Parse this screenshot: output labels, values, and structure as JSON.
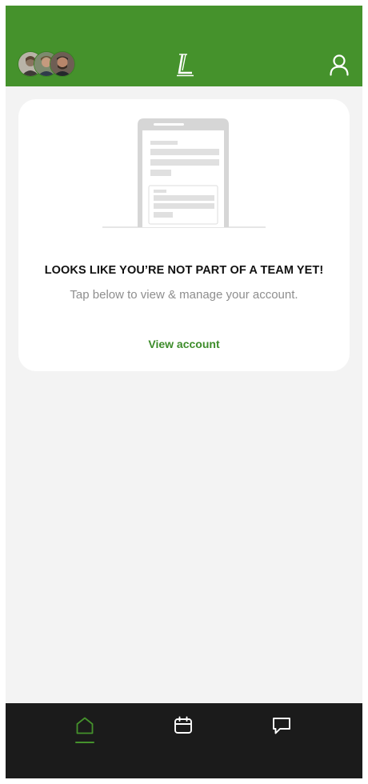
{
  "header": {
    "logo_letter": "L",
    "avatars": [
      "avatar-1",
      "avatar-2",
      "avatar-3"
    ]
  },
  "card": {
    "title": "LOOKS LIKE YOU’RE NOT PART OF A TEAM YET!",
    "subtitle": "Tap below to view & manage your account.",
    "link_label": "View account"
  },
  "nav": {
    "items": [
      {
        "icon": "home-icon",
        "active": true
      },
      {
        "icon": "calendar-icon",
        "active": false
      },
      {
        "icon": "chat-icon",
        "active": false
      }
    ]
  },
  "colors": {
    "brand_green": "#45922c",
    "nav_background": "#1b1b1b",
    "page_background": "#f3f3f3",
    "link_green": "#3d8c2a"
  }
}
